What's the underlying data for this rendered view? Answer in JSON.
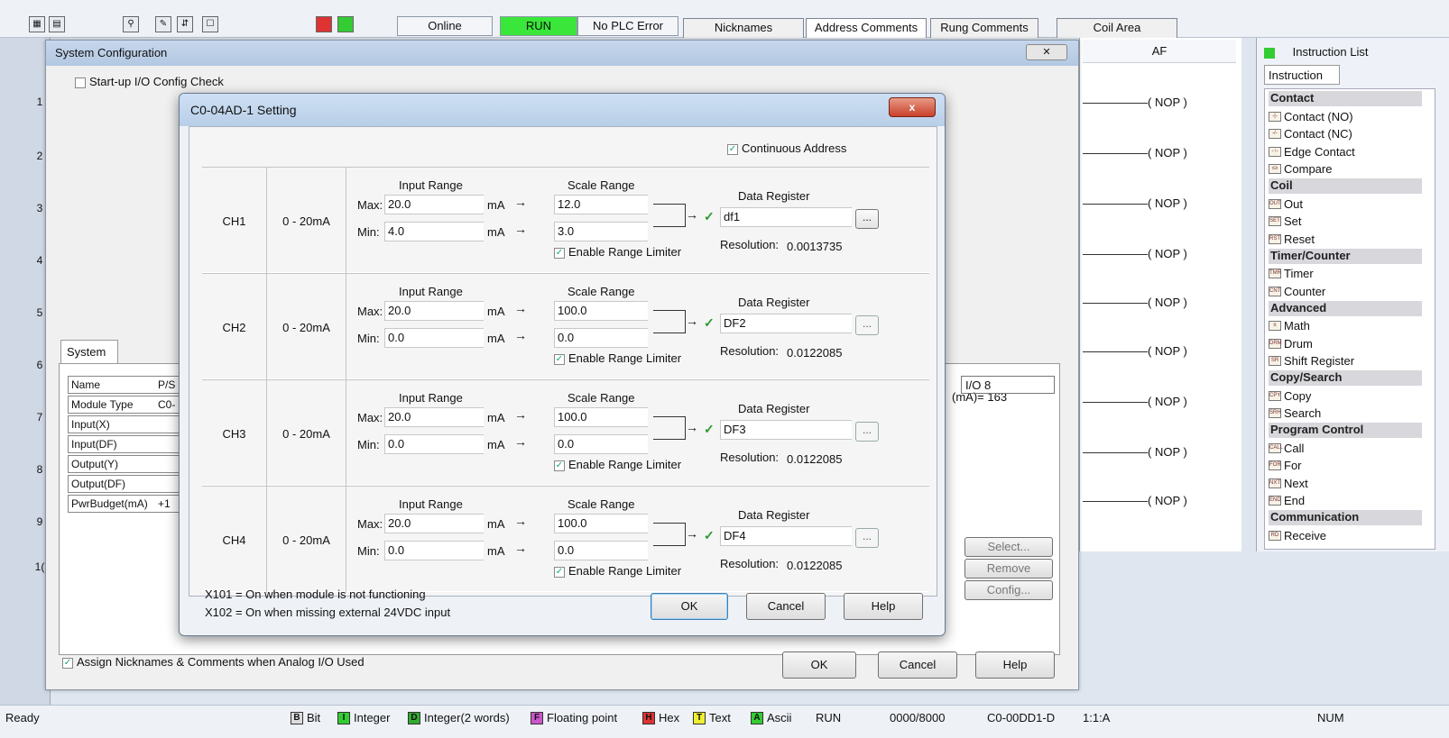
{
  "toolbar": {
    "online": "Online",
    "run": "RUN",
    "plc_error": "No PLC Error",
    "tabs": [
      "Nicknames",
      "Address Comments",
      "Rung Comments",
      "Coil Area"
    ]
  },
  "ladder": {
    "column_header": "AF",
    "rows": [
      "1",
      "2",
      "3",
      "4",
      "5",
      "6",
      "7",
      "8",
      "9",
      "1("
    ],
    "nop": "( NOP )",
    "rung_label": "(mA)= 163",
    "io8": "I/O 8"
  },
  "instruction_list": {
    "title": "Instruction List",
    "combo": "Instruction",
    "groups": [
      {
        "head": "Contact",
        "items": [
          [
            "-|-",
            "Contact (NO)"
          ],
          [
            "-/-",
            "Contact (NC)"
          ],
          [
            "-↑-",
            "Edge Contact"
          ],
          [
            "≤≥",
            "Compare"
          ]
        ]
      },
      {
        "head": "Coil",
        "items": [
          [
            "OUT",
            "Out"
          ],
          [
            "SET",
            "Set"
          ],
          [
            "RST",
            "Reset"
          ]
        ]
      },
      {
        "head": "Timer/Counter",
        "items": [
          [
            "TMR",
            "Timer"
          ],
          [
            "CNT",
            "Counter"
          ]
        ]
      },
      {
        "head": "Advanced",
        "items": [
          [
            "±",
            "Math"
          ],
          [
            "DRM",
            "Drum"
          ],
          [
            "SR",
            "Shift Register"
          ]
        ]
      },
      {
        "head": "Copy/Search",
        "items": [
          [
            "CPY",
            "Copy"
          ],
          [
            "SRH",
            "Search"
          ]
        ]
      },
      {
        "head": "Program Control",
        "items": [
          [
            "CALL",
            "Call"
          ],
          [
            "FOR",
            "For"
          ],
          [
            "NXT",
            "Next"
          ],
          [
            "END",
            "End"
          ]
        ]
      },
      {
        "head": "Communication",
        "items": [
          [
            "RD",
            "Receive"
          ]
        ]
      }
    ]
  },
  "syscfg": {
    "title": "System Configuration",
    "startup_check": "Start-up I/O Config Check",
    "tab_system": "System",
    "table_rows": [
      "Name",
      "Module Type",
      "Input(X)",
      "Input(DF)",
      "Output(Y)",
      "Output(DF)",
      "PwrBudget(mA)"
    ],
    "table_col2": [
      "P/S",
      "C0-",
      "",
      "",
      "",
      "",
      "+1"
    ],
    "side_buttons": [
      "Select...",
      "Remove",
      "Config..."
    ],
    "assign_label": "Assign Nicknames & Comments when Analog I/O Used",
    "ok": "OK",
    "cancel": "Cancel",
    "help": "Help"
  },
  "dialog": {
    "title": "C0-04AD-1 Setting",
    "close": "x",
    "continuous": "Continuous Address",
    "labels": {
      "input_range": "Input Range",
      "scale_range": "Scale Range",
      "data_register": "Data Register",
      "max": "Max:",
      "min": "Min:",
      "unit": "mA",
      "limiter": "Enable Range Limiter",
      "resolution": "Resolution:"
    },
    "channels": [
      {
        "name": "CH1",
        "range": "0 - 20mA",
        "in_max": "20.0",
        "in_min": "4.0",
        "sc_max": "12.0",
        "sc_min": "3.0",
        "register": "df1",
        "resolution": "0.0013735"
      },
      {
        "name": "CH2",
        "range": "0 - 20mA",
        "in_max": "20.0",
        "in_min": "0.0",
        "sc_max": "100.0",
        "sc_min": "0.0",
        "register": "DF2",
        "resolution": "0.0122085"
      },
      {
        "name": "CH3",
        "range": "0 - 20mA",
        "in_max": "20.0",
        "in_min": "0.0",
        "sc_max": "100.0",
        "sc_min": "0.0",
        "register": "DF3",
        "resolution": "0.0122085"
      },
      {
        "name": "CH4",
        "range": "0 - 20mA",
        "in_max": "20.0",
        "in_min": "0.0",
        "sc_max": "100.0",
        "sc_min": "0.0",
        "register": "DF4",
        "resolution": "0.0122085"
      }
    ],
    "note1": "X101 = On when module is not functioning",
    "note2": "X102 = On when missing external 24VDC input",
    "ok": "OK",
    "cancel": "Cancel",
    "help": "Help"
  },
  "status": {
    "ready": "Ready",
    "bit": "Bit",
    "integer": "Integer",
    "integer2": "Integer(2 words)",
    "float": "Floating point",
    "hex": "Hex",
    "text": "Text",
    "ascii": "Ascii",
    "mode": "RUN",
    "count": "0000/8000",
    "model": "C0-00DD1-D",
    "ratio": "1:1:A",
    "num": "NUM",
    "codes": {
      "bit": "B",
      "integer": "I",
      "integer2": "D",
      "float": "F",
      "hex": "H",
      "text": "T",
      "ascii": "A"
    }
  }
}
